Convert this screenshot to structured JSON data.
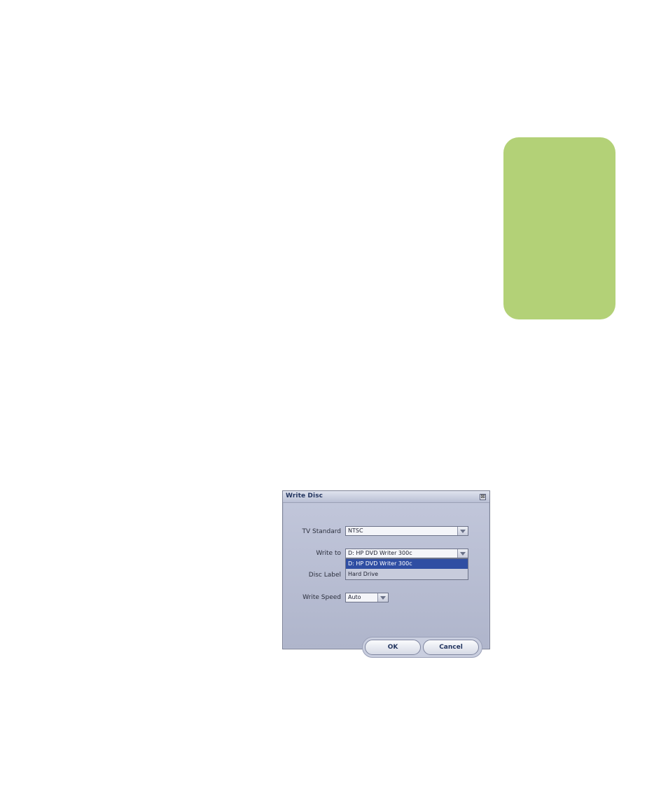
{
  "dialog": {
    "title": "Write Disc",
    "close_glyph": "⊠",
    "tv_standard": {
      "label": "TV Standard",
      "value": "NTSC"
    },
    "write_to": {
      "label": "Write to",
      "value": "D: HP DVD Writer 300c",
      "options": [
        "D: HP DVD Writer 300c",
        "Hard Drive"
      ],
      "selected_index": 0
    },
    "disc_label": {
      "label": "Disc Label"
    },
    "write_speed": {
      "label": "Write Speed",
      "value": "Auto"
    },
    "ok_label": "OK",
    "cancel_label": "Cancel"
  },
  "colors": {
    "tab_green": "#b3d177",
    "dialog_bg": "#b6bcd2",
    "selection_blue": "#2f4ea3"
  }
}
